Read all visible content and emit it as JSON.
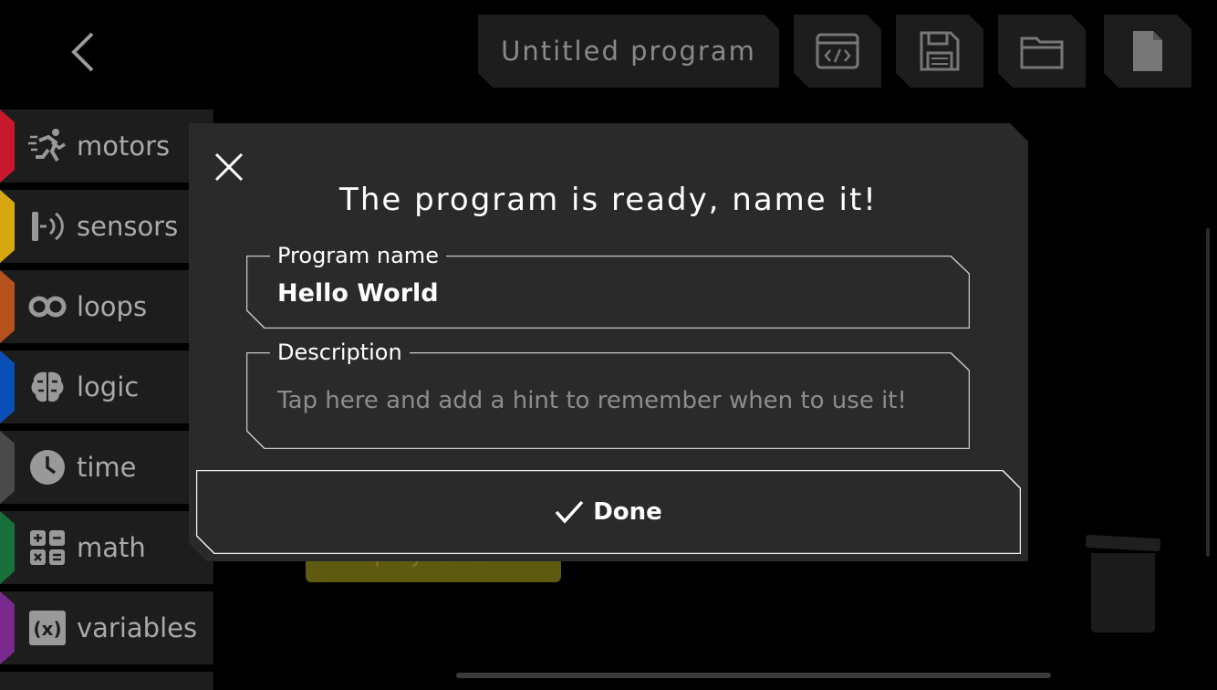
{
  "header": {
    "program_title": "Untitled program",
    "actions": [
      {
        "icon": "code-icon"
      },
      {
        "icon": "save-icon"
      },
      {
        "icon": "folder-icon"
      },
      {
        "icon": "new-file-icon"
      }
    ]
  },
  "sidebar": {
    "items": [
      {
        "label": "motors",
        "color": "#c8182b",
        "icon": "running-icon"
      },
      {
        "label": "sensors",
        "color": "#d7a70f",
        "icon": "sensor-icon"
      },
      {
        "label": "loops",
        "color": "#b5511a",
        "icon": "infinity-icon"
      },
      {
        "label": "logic",
        "color": "#0a4fb5",
        "icon": "brain-icon"
      },
      {
        "label": "time",
        "color": "#4a4a4a",
        "icon": "clock-icon"
      },
      {
        "label": "math",
        "color": "#18703a",
        "icon": "calculator-icon"
      },
      {
        "label": "variables",
        "color": "#7a2a8c",
        "icon": "variable-icon"
      }
    ]
  },
  "canvas": {
    "block_label": "play tune"
  },
  "dialog": {
    "title": "The program is ready, name it!",
    "name_field": {
      "label": "Program name",
      "value": "Hello World"
    },
    "description_field": {
      "label": "Description",
      "placeholder": "Tap here and add a hint to remember when to use it!"
    },
    "done_label": "Done"
  }
}
